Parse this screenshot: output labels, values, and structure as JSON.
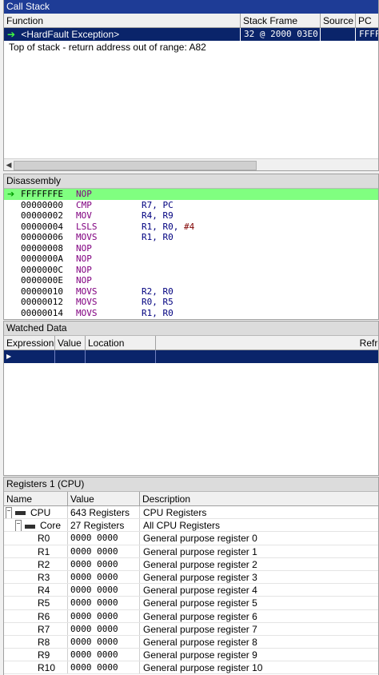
{
  "call_stack": {
    "title": "Call Stack",
    "columns": [
      "Function",
      "Stack Frame",
      "Source",
      "PC"
    ],
    "selected_row": {
      "function": "<HardFault Exception>",
      "stack_frame": "32 @ 2000 03E0",
      "source": "",
      "pc": "FFFF"
    },
    "message": "Top of stack - return address out of range: A82",
    "arrow_glyph": "➔"
  },
  "disassembly": {
    "title": "Disassembly",
    "rows": [
      {
        "marker": "➔",
        "addr": "FFFFFFFE",
        "mnem": "NOP",
        "ops": "",
        "imm": ""
      },
      {
        "marker": "",
        "addr": "00000000",
        "mnem": "CMP",
        "ops": "R7, PC",
        "imm": ""
      },
      {
        "marker": "",
        "addr": "00000002",
        "mnem": "MOV",
        "ops": "R4, R9",
        "imm": ""
      },
      {
        "marker": "",
        "addr": "00000004",
        "mnem": "LSLS",
        "ops": "R1, R0, ",
        "imm": "#4"
      },
      {
        "marker": "",
        "addr": "00000006",
        "mnem": "MOVS",
        "ops": "R1, R0",
        "imm": ""
      },
      {
        "marker": "",
        "addr": "00000008",
        "mnem": "NOP",
        "ops": "",
        "imm": ""
      },
      {
        "marker": "",
        "addr": "0000000A",
        "mnem": "NOP",
        "ops": "",
        "imm": ""
      },
      {
        "marker": "",
        "addr": "0000000C",
        "mnem": "NOP",
        "ops": "",
        "imm": ""
      },
      {
        "marker": "",
        "addr": "0000000E",
        "mnem": "NOP",
        "ops": "",
        "imm": ""
      },
      {
        "marker": "",
        "addr": "00000010",
        "mnem": "MOVS",
        "ops": "R2, R0",
        "imm": ""
      },
      {
        "marker": "",
        "addr": "00000012",
        "mnem": "MOVS",
        "ops": "R0, R5",
        "imm": ""
      },
      {
        "marker": "",
        "addr": "00000014",
        "mnem": "MOVS",
        "ops": "R1, R0",
        "imm": ""
      }
    ]
  },
  "watched_data": {
    "title": "Watched Data",
    "columns": [
      "Expression",
      "Value",
      "Location",
      "Refre"
    ]
  },
  "registers": {
    "title": "Registers 1 (CPU)",
    "columns": [
      "Name",
      "Value",
      "Description"
    ],
    "groups": [
      {
        "name": "CPU",
        "value": "643 Registers",
        "desc": "CPU Registers",
        "expand": "−"
      },
      {
        "name": "Core",
        "value": "27 Registers",
        "desc": "All CPU Registers",
        "expand": "−"
      }
    ],
    "rows": [
      {
        "name": "R0",
        "value": "0000 0000",
        "desc": "General purpose register 0"
      },
      {
        "name": "R1",
        "value": "0000 0000",
        "desc": "General purpose register 1"
      },
      {
        "name": "R2",
        "value": "0000 0000",
        "desc": "General purpose register 2"
      },
      {
        "name": "R3",
        "value": "0000 0000",
        "desc": "General purpose register 3"
      },
      {
        "name": "R4",
        "value": "0000 0000",
        "desc": "General purpose register 4"
      },
      {
        "name": "R5",
        "value": "0000 0000",
        "desc": "General purpose register 5"
      },
      {
        "name": "R6",
        "value": "0000 0000",
        "desc": "General purpose register 6"
      },
      {
        "name": "R7",
        "value": "0000 0000",
        "desc": "General purpose register 7"
      },
      {
        "name": "R8",
        "value": "0000 0000",
        "desc": "General purpose register 8"
      },
      {
        "name": "R9",
        "value": "0000 0000",
        "desc": "General purpose register 9"
      },
      {
        "name": "R10",
        "value": "0000 0000",
        "desc": "General purpose register 10"
      }
    ]
  },
  "colors": {
    "active_title": "#1e3c96",
    "selection": "#0a246a",
    "current_line": "#80ff80",
    "mnemonic": "#800080"
  }
}
